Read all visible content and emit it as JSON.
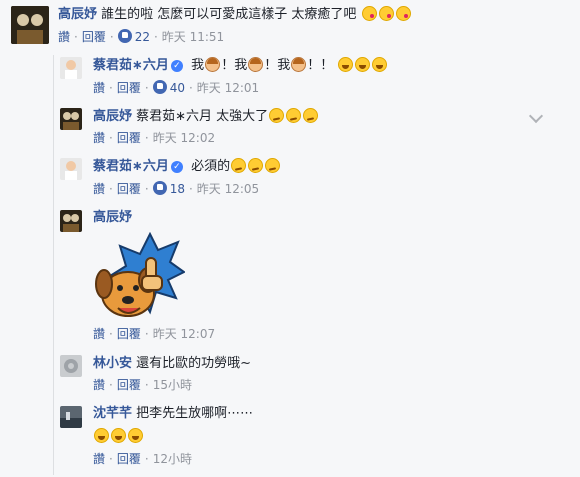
{
  "labels": {
    "like": "讚",
    "reply": "回覆"
  },
  "comments": [
    {
      "author": "高辰妤",
      "text": "誰生的啦 怎麼可以可愛成這樣子 太療癒了吧",
      "likes": "22",
      "time": "昨天 11:51"
    },
    {
      "author": "蔡君茹∗六月",
      "text_parts": [
        "我",
        "！我",
        "！我",
        "！！"
      ],
      "likes": "40",
      "time": "昨天 12:01"
    },
    {
      "author": "高辰妤",
      "text": "蔡君茹∗六月 太強大了",
      "time": "昨天 12:02"
    },
    {
      "author": "蔡君茹∗六月",
      "text": "必須的",
      "likes": "18",
      "time": "昨天 12:05"
    },
    {
      "author": "高辰妤",
      "sticker": "dog-thumbs-up-sticker",
      "time": "昨天 12:07"
    },
    {
      "author": "林小安",
      "text": "還有比歐的功勞哦~",
      "time": "15小時"
    },
    {
      "author": "沈芊芊",
      "text": "把李先生放哪啊⋯⋯",
      "time": "12小時"
    }
  ],
  "colors": {
    "link": "#365899",
    "like_badge": "#4267b2",
    "background": "#f6f7f9"
  }
}
